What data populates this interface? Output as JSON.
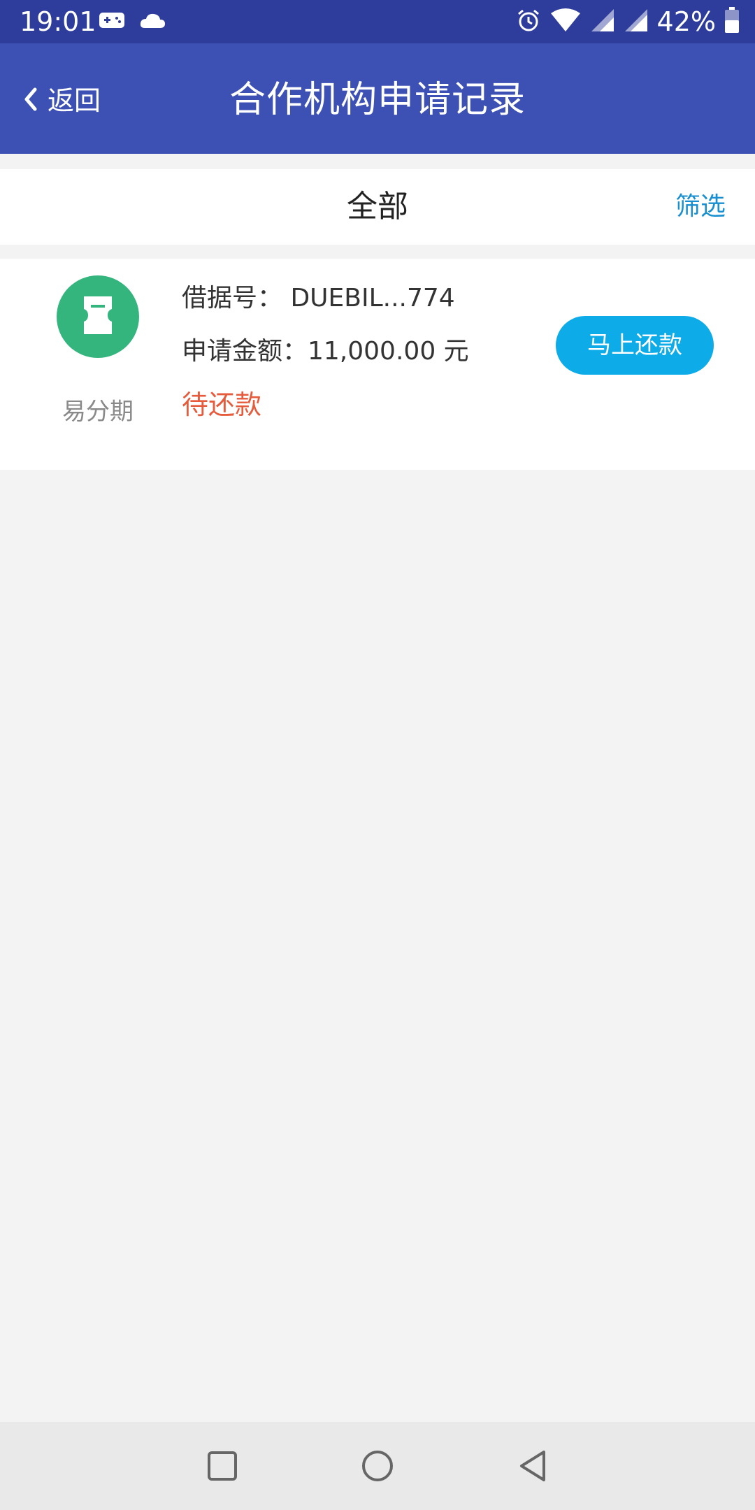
{
  "status_bar": {
    "time": "19:01",
    "icons": [
      "gamepad-icon",
      "cloud-icon",
      "alarm-icon",
      "wifi-icon",
      "signal-icon",
      "signal-icon",
      "battery-icon"
    ],
    "battery_text": "42%"
  },
  "app_bar": {
    "back_label": "返回",
    "title": "合作机构申请记录"
  },
  "filter_bar": {
    "tab_label": "全部",
    "filter_label": "筛选"
  },
  "record": {
    "org_name": "易分期",
    "org_icon": "document-icon",
    "loan_no_line": "借据号：  DUEBIL...774",
    "amount_line": "申请金额：11,000.00 元",
    "status": "待还款",
    "action_label": "马上还款"
  },
  "colors": {
    "status_bar": "#2e3c9b",
    "app_bar": "#3d51b4",
    "accent_button": "#0eabe9",
    "logo_green": "#35b57e",
    "status_red": "#e55b3c",
    "filter_link": "#1a8fcf",
    "background": "#f3f3f4"
  },
  "nav_bar": {
    "buttons": [
      "recents-square-icon",
      "home-circle-icon",
      "back-triangle-icon"
    ]
  }
}
